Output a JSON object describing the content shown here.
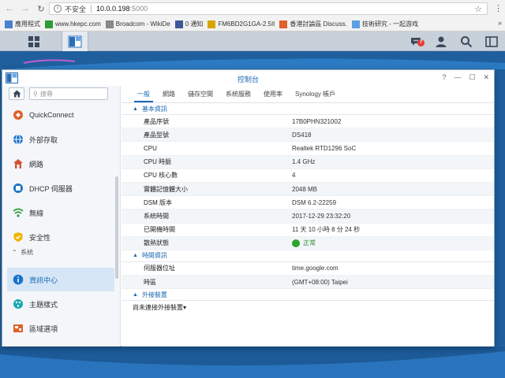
{
  "browser": {
    "security_label": "不安全",
    "url_host": "10.0.0.198",
    "url_port": ":5000",
    "bookmarks": [
      {
        "label": "應用程式",
        "icon": "apps-grid-icon",
        "color": "#4a7fd1"
      },
      {
        "label": "www.hkepc.com",
        "icon": "site-icon",
        "color": "#2e9b3a"
      },
      {
        "label": "Broadcom - WikiDe",
        "icon": "page-icon",
        "color": "#888888"
      },
      {
        "label": "0 通知",
        "icon": "facebook-icon",
        "color": "#3b5998"
      },
      {
        "label": "FM6BD2G1GA-2.5II",
        "icon": "bookmark-icon",
        "color": "#d9a400"
      },
      {
        "label": "香港討論區 Discuss.",
        "icon": "discuss-icon",
        "color": "#e0612a"
      },
      {
        "label": "技術研究 - 一起游戏",
        "icon": "game-icon",
        "color": "#5aa0e0"
      }
    ]
  },
  "taskbar": {
    "notification_count": "7"
  },
  "window": {
    "title": "控制台",
    "controls": [
      "?",
      "—",
      "☐",
      "✕"
    ]
  },
  "sidebar": {
    "search_placeholder": "搜尋",
    "items": [
      {
        "label": "QuickConnect",
        "icon": "quickconnect-icon",
        "color": "#e0612a"
      },
      {
        "label": "外部存取",
        "icon": "globe-icon",
        "color": "#1a73c9"
      },
      {
        "label": "網路",
        "icon": "house-network-icon",
        "color": "#d0543a"
      },
      {
        "label": "DHCP 伺服器",
        "icon": "dhcp-icon",
        "color": "#1a73c9"
      },
      {
        "label": "無線",
        "icon": "wifi-icon",
        "color": "#2e9b3a"
      },
      {
        "label": "安全性",
        "icon": "shield-icon",
        "color": "#f0b400"
      },
      {
        "label": "資訊中心",
        "icon": "info-icon",
        "color": "#1a73c9"
      },
      {
        "label": "主題樣式",
        "icon": "theme-icon",
        "color": "#1aa7b0"
      },
      {
        "label": "區域選項",
        "icon": "region-icon",
        "color": "#e0612a"
      }
    ],
    "group_label": "系統"
  },
  "tabs": [
    "一般",
    "網路",
    "儲存空間",
    "系統服務",
    "使用率",
    "Synology 帳戶"
  ],
  "sections": {
    "basic": {
      "title": "基本資訊",
      "rows": [
        {
          "key": "產品序號",
          "value": "17B0PHN321002"
        },
        {
          "key": "產品型號",
          "value": "DS418"
        },
        {
          "key": "CPU",
          "value": "Realtek RTD1296 SoC"
        },
        {
          "key": "CPU 時脈",
          "value": "1.4 GHz"
        },
        {
          "key": "CPU 核心數",
          "value": "4"
        },
        {
          "key": "實體記憶體大小",
          "value": "2048 MB"
        },
        {
          "key": "DSM 版本",
          "value": "DSM 6.2-22259"
        },
        {
          "key": "系統時間",
          "value": "2017-12-29 23:32:20"
        },
        {
          "key": "已開機時間",
          "value": "11 天 10 小時 8 分 24 秒"
        },
        {
          "key": "散熱狀態",
          "value": "正常"
        }
      ]
    },
    "time": {
      "title": "時間資訊",
      "rows": [
        {
          "key": "伺服器位址",
          "value": "time.google.com"
        },
        {
          "key": "時區",
          "value": "(GMT+08:00) Taipei"
        }
      ]
    },
    "external": {
      "title": "外接裝置",
      "note": "尚未連接外接裝置"
    }
  }
}
